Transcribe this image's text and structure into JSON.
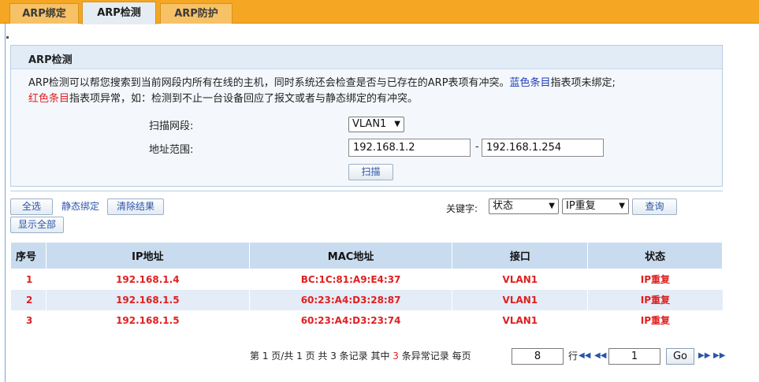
{
  "tabs": [
    {
      "label": "ARP绑定"
    },
    {
      "label": "ARP检测"
    },
    {
      "label": "ARP防护"
    }
  ],
  "panel": {
    "title": "ARP检测",
    "desc_line1_a": "ARP检测可以帮您搜索到当前网段内所有在线的主机，同时系统还会检查是否与已存在的ARP表项有冲突。",
    "desc_line1_blue": "蓝色条目",
    "desc_line1_b": "指表项未绑定;",
    "desc_line2_red": "红色条目",
    "desc_line2_b": "指表项异常，如：检测到不止一台设备回应了报文或者与静态绑定的有冲突。"
  },
  "form": {
    "scan_label": "扫描网段:",
    "scan_value": "VLAN1",
    "range_label": "地址范围:",
    "range_start": "192.168.1.2",
    "range_sep": "-",
    "range_end": "192.168.1.254",
    "scan_button": "扫描"
  },
  "toolbar": {
    "select_all": "全选",
    "static_bind": "静态绑定",
    "clear_results": "清除结果",
    "show_all": "显示全部",
    "keyword_label": "关键字:",
    "keyword_field": "状态",
    "keyword_value": "IP重复",
    "query": "查询"
  },
  "table": {
    "headers": [
      "序号",
      "IP地址",
      "MAC地址",
      "接口",
      "状态"
    ],
    "rows": [
      {
        "seq": "1",
        "ip": "192.168.1.4",
        "mac": "BC:1C:81:A9:E4:37",
        "iface": "VLAN1",
        "status": "IP重复"
      },
      {
        "seq": "2",
        "ip": "192.168.1.5",
        "mac": "60:23:A4:D3:28:87",
        "iface": "VLAN1",
        "status": "IP重复"
      },
      {
        "seq": "3",
        "ip": "192.168.1.5",
        "mac": "60:23:A4:D3:23:74",
        "iface": "VLAN1",
        "status": "IP重复"
      }
    ]
  },
  "pager": {
    "summary_a": "第 1 页/共 1 页 共 3 条记录 其中",
    "abnormal_count": "3",
    "summary_b": "条异常记录 每页",
    "per_page": "8",
    "rows_unit": "行",
    "page_input": "1",
    "go": "Go"
  },
  "colors": {
    "tab_bar": "#f5a623",
    "header_bg": "#c9dbee",
    "row_alt": "#e3ecf7",
    "abnormal_text": "#e02020",
    "untied_text": "#1f3cb8"
  }
}
